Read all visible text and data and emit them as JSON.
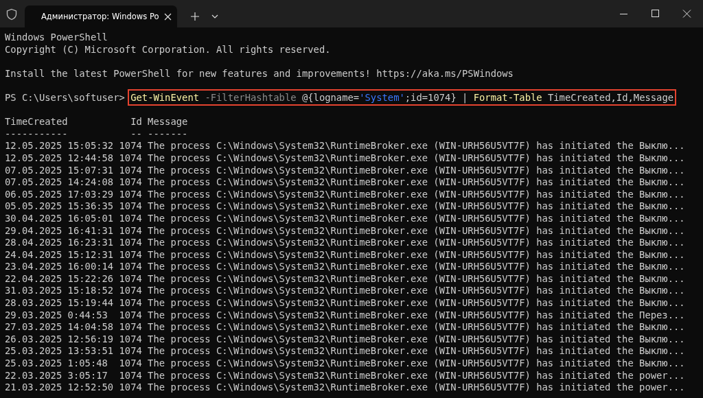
{
  "window": {
    "tab": {
      "title": "Администратор: Windows Po",
      "selected": true
    }
  },
  "console": {
    "header_lines": [
      "Windows PowerShell",
      "Copyright (C) Microsoft Corporation. All rights reserved."
    ],
    "notice": "Install the latest PowerShell for new features and improvements! https://aka.ms/PSWindows",
    "prompt": "PS C:\\Users\\softuser>",
    "command": {
      "highlighted": true,
      "tokens": [
        {
          "kind": "cmdlet",
          "text": "Get-WinEvent"
        },
        {
          "kind": "parameter",
          "text": " -FilterHashtable "
        },
        {
          "kind": "plain",
          "text": "@{logname="
        },
        {
          "kind": "string",
          "text": "'System'"
        },
        {
          "kind": "plain",
          "text": ";id=1074} | "
        },
        {
          "kind": "cmdlet",
          "text": "Format-Table"
        },
        {
          "kind": "plain",
          "text": " TimeCreated,Id,Message"
        }
      ]
    },
    "table": {
      "columns": [
        {
          "label": "TimeCreated",
          "rule": "-----------"
        },
        {
          "label": "Id",
          "rule": "--"
        },
        {
          "label": "Message",
          "rule": "-------"
        }
      ],
      "rows": [
        {
          "time": "12.05.2025 15:05:32",
          "id": "1074",
          "message": "The process C:\\Windows\\System32\\RuntimeBroker.exe (WIN-URH56U5VT7F) has initiated the Выклю..."
        },
        {
          "time": "12.05.2025 12:44:58",
          "id": "1074",
          "message": "The process C:\\Windows\\System32\\RuntimeBroker.exe (WIN-URH56U5VT7F) has initiated the Выклю..."
        },
        {
          "time": "07.05.2025 15:07:31",
          "id": "1074",
          "message": "The process C:\\Windows\\System32\\RuntimeBroker.exe (WIN-URH56U5VT7F) has initiated the Выклю..."
        },
        {
          "time": "07.05.2025 14:24:08",
          "id": "1074",
          "message": "The process C:\\Windows\\System32\\RuntimeBroker.exe (WIN-URH56U5VT7F) has initiated the Выклю..."
        },
        {
          "time": "06.05.2025 17:03:29",
          "id": "1074",
          "message": "The process C:\\Windows\\System32\\RuntimeBroker.exe (WIN-URH56U5VT7F) has initiated the Выклю..."
        },
        {
          "time": "05.05.2025 15:36:35",
          "id": "1074",
          "message": "The process C:\\Windows\\System32\\RuntimeBroker.exe (WIN-URH56U5VT7F) has initiated the Выклю..."
        },
        {
          "time": "30.04.2025 16:05:01",
          "id": "1074",
          "message": "The process C:\\Windows\\System32\\RuntimeBroker.exe (WIN-URH56U5VT7F) has initiated the Выклю..."
        },
        {
          "time": "29.04.2025 16:41:31",
          "id": "1074",
          "message": "The process C:\\Windows\\System32\\RuntimeBroker.exe (WIN-URH56U5VT7F) has initiated the Выклю..."
        },
        {
          "time": "28.04.2025 16:23:31",
          "id": "1074",
          "message": "The process C:\\Windows\\System32\\RuntimeBroker.exe (WIN-URH56U5VT7F) has initiated the Выклю..."
        },
        {
          "time": "24.04.2025 15:12:31",
          "id": "1074",
          "message": "The process C:\\Windows\\System32\\RuntimeBroker.exe (WIN-URH56U5VT7F) has initiated the Выклю..."
        },
        {
          "time": "23.04.2025 16:00:14",
          "id": "1074",
          "message": "The process C:\\Windows\\System32\\RuntimeBroker.exe (WIN-URH56U5VT7F) has initiated the Выклю..."
        },
        {
          "time": "22.04.2025 15:22:26",
          "id": "1074",
          "message": "The process C:\\Windows\\System32\\RuntimeBroker.exe (WIN-URH56U5VT7F) has initiated the Выклю..."
        },
        {
          "time": "31.03.2025 15:18:52",
          "id": "1074",
          "message": "The process C:\\Windows\\System32\\RuntimeBroker.exe (WIN-URH56U5VT7F) has initiated the Выклю..."
        },
        {
          "time": "28.03.2025 15:19:44",
          "id": "1074",
          "message": "The process C:\\Windows\\System32\\RuntimeBroker.exe (WIN-URH56U5VT7F) has initiated the Выклю..."
        },
        {
          "time": "29.03.2025 0:44:53",
          "id": "1074",
          "message": "The process C:\\Windows\\System32\\RuntimeBroker.exe (WIN-URH56U5VT7F) has initiated the Перез..."
        },
        {
          "time": "27.03.2025 14:04:58",
          "id": "1074",
          "message": "The process C:\\Windows\\System32\\RuntimeBroker.exe (WIN-URH56U5VT7F) has initiated the Выклю..."
        },
        {
          "time": "26.03.2025 12:56:19",
          "id": "1074",
          "message": "The process C:\\Windows\\System32\\RuntimeBroker.exe (WIN-URH56U5VT7F) has initiated the Выклю..."
        },
        {
          "time": "25.03.2025 13:53:51",
          "id": "1074",
          "message": "The process C:\\Windows\\System32\\RuntimeBroker.exe (WIN-URH56U5VT7F) has initiated the Выклю..."
        },
        {
          "time": "25.03.2025 1:05:48",
          "id": "1074",
          "message": "The process C:\\Windows\\System32\\RuntimeBroker.exe (WIN-URH56U5VT7F) has initiated the Выклю..."
        },
        {
          "time": "22.03.2025 3:05:17",
          "id": "1074",
          "message": "The process C:\\Windows\\System32\\RuntimeBroker.exe (WIN-URH56U5VT7F) has initiated the power..."
        },
        {
          "time": "21.03.2025 12:52:50",
          "id": "1074",
          "message": "The process C:\\Windows\\System32\\RuntimeBroker.exe (WIN-URH56U5VT7F) has initiated the power..."
        }
      ]
    }
  }
}
